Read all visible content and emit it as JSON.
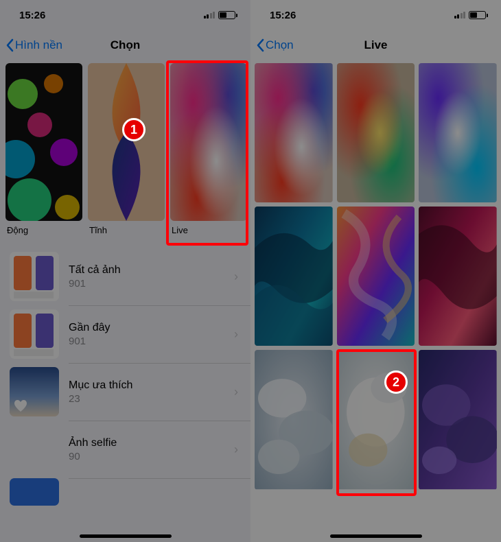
{
  "status": {
    "time": "15:26"
  },
  "left": {
    "back_label": "Hình nền",
    "title": "Chọn",
    "categories": [
      {
        "label": "Động"
      },
      {
        "label": "Tĩnh"
      },
      {
        "label": "Live"
      }
    ],
    "albums": [
      {
        "name": "Tất cả ảnh",
        "count": "901"
      },
      {
        "name": "Gần đây",
        "count": "901"
      },
      {
        "name": "Mục ưa thích",
        "count": "23"
      },
      {
        "name": "Ảnh selfie",
        "count": "90"
      }
    ]
  },
  "right": {
    "back_label": "Chọn",
    "title": "Live"
  },
  "markers": {
    "one": "1",
    "two": "2"
  }
}
